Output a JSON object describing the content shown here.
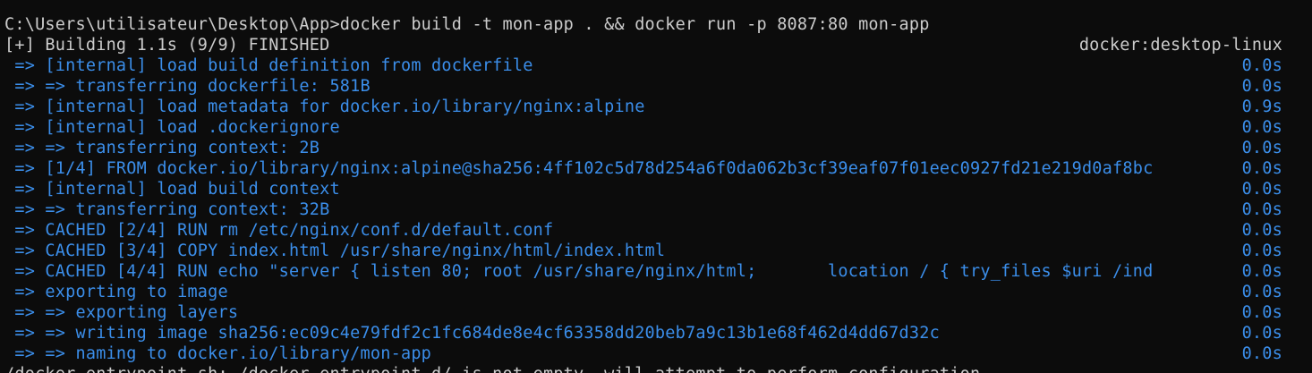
{
  "terminal": {
    "command_line": "C:\\Users\\utilisateur\\Desktop\\App>docker build -t mon-app . && docker run -p 8087:80 mon-app",
    "build_header": {
      "status": "[+] Building 1.1s (9/9) FINISHED",
      "builder": "docker:desktop-linux"
    },
    "steps": [
      {
        "text": " => [internal] load build definition from dockerfile",
        "time": "0.0s"
      },
      {
        "text": " => => transferring dockerfile: 581B",
        "time": "0.0s"
      },
      {
        "text": " => [internal] load metadata for docker.io/library/nginx:alpine",
        "time": "0.9s"
      },
      {
        "text": " => [internal] load .dockerignore",
        "time": "0.0s"
      },
      {
        "text": " => => transferring context: 2B",
        "time": "0.0s"
      },
      {
        "text": " => [1/4] FROM docker.io/library/nginx:alpine@sha256:4ff102c5d78d254a6f0da062b3cf39eaf07f01eec0927fd21e219d0af8bc",
        "time": "0.0s"
      },
      {
        "text": " => [internal] load build context",
        "time": "0.0s"
      },
      {
        "text": " => => transferring context: 32B",
        "time": "0.0s"
      },
      {
        "text": " => CACHED [2/4] RUN rm /etc/nginx/conf.d/default.conf",
        "time": "0.0s"
      },
      {
        "text": " => CACHED [3/4] COPY index.html /usr/share/nginx/html/index.html",
        "time": "0.0s"
      },
      {
        "text": " => CACHED [4/4] RUN echo \"server { listen 80; root /usr/share/nginx/html;       location / { try_files $uri /ind",
        "time": "0.0s"
      },
      {
        "text": " => exporting to image",
        "time": "0.0s"
      },
      {
        "text": " => => exporting layers",
        "time": "0.0s"
      },
      {
        "text": " => => writing image sha256:ec09c4e79fdf2c1fc684de8e4cf63358dd20beb7a9c13b1e68f462d4dd67d32c",
        "time": "0.0s"
      },
      {
        "text": " => => naming to docker.io/library/mon-app",
        "time": "0.0s"
      }
    ],
    "partial_line": "/docker-entrypoint.sh: /docker-entrypoint.d/ is not empty, will attempt to perform configuration"
  },
  "colors": {
    "background": "#0c0c0c",
    "foreground": "#cccccc",
    "step_blue": "#3b8eea"
  }
}
